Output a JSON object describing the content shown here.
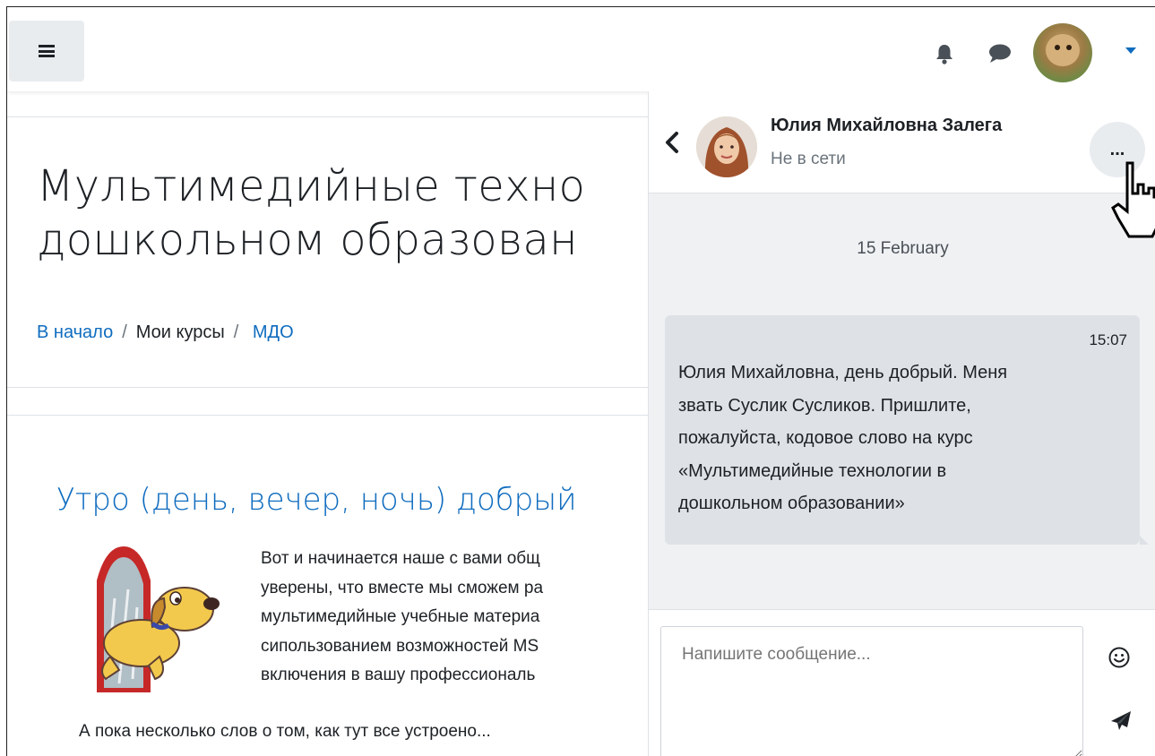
{
  "navbar": {
    "menu_icon": "hamburger-icon",
    "notifications_icon": "bell-icon",
    "messages_icon": "chat-bubble-icon",
    "user_menu_icon": "caret-down-icon",
    "accent_color": "#0f6cbf"
  },
  "page": {
    "title_line1": "Мультимедийные техно",
    "title_line2": "дошкольном образован",
    "breadcrumb": [
      {
        "label": "В начало",
        "link": true
      },
      {
        "label": "Мои курсы",
        "link": false
      },
      {
        "label": "МДО",
        "link": true
      }
    ],
    "breadcrumb_separator": "/",
    "section_title": "Утро (день, вечер, ночь) добрый",
    "intro_lines": [
      "Вот и начинается наше с вами общ",
      "уверены, что вместе мы сможем ра",
      "мультимедийные учебные материа",
      "сипользованием возможностей MS",
      "включения в вашу профессиональ"
    ],
    "intro_last": "А пока несколько слов о том, как тут все устроено..."
  },
  "drawer": {
    "back_icon": "chevron-left-icon",
    "contact_name": "Юлия Михайловна Залега",
    "contact_status": "Не в сети",
    "more_label": "...",
    "date_separator": "15 February",
    "message": {
      "time": "15:07",
      "lines": [
        "Юлия Михайловна, день добрый. Меня",
        "звать Суслик Сусликов. Пришлите,",
        "пожалуйста, кодовое слово на курс",
        "«Мультимедийные технологии в",
        "дошкольном образовании»"
      ]
    },
    "composer_placeholder": "Напишите сообщение...",
    "emoji_icon": "smiley-icon",
    "send_icon": "paper-plane-icon"
  }
}
